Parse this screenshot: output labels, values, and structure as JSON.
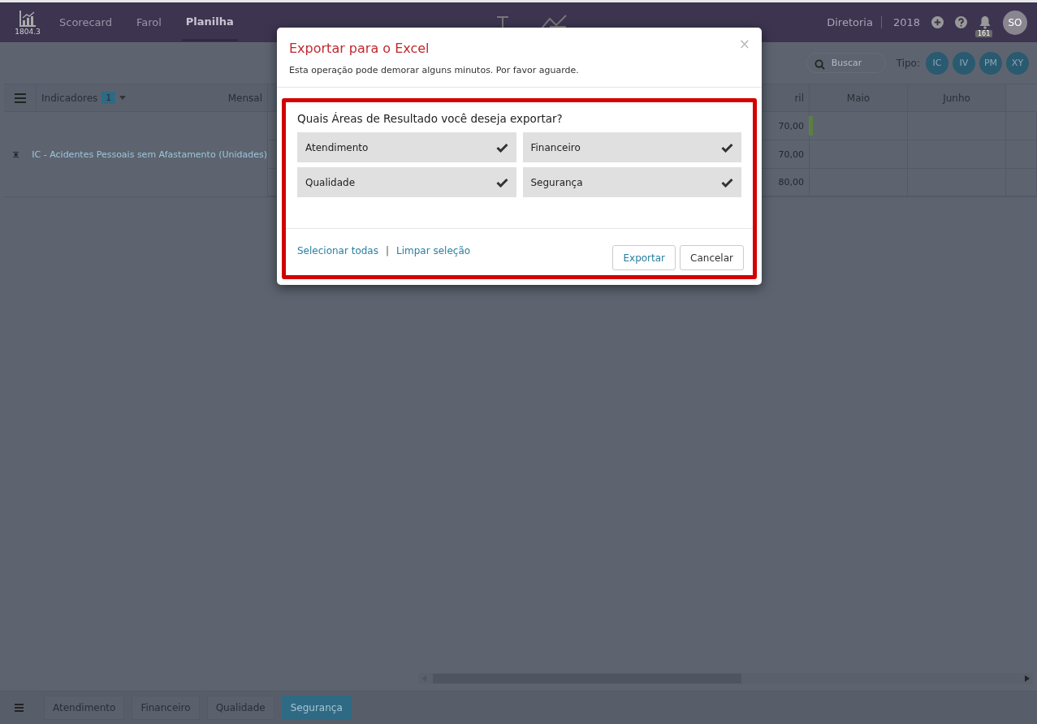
{
  "topbar": {
    "version": "1804.3",
    "nav": [
      {
        "label": "Scorecard",
        "selected": false
      },
      {
        "label": "Farol",
        "selected": false
      },
      {
        "label": "Planilha",
        "selected": true
      }
    ],
    "unit": "Diretoria",
    "year": "2018",
    "notifications": "161",
    "avatar": "SO"
  },
  "toolbar": {
    "search": {
      "placeholder": "Buscar"
    },
    "type_label": "Tipo:",
    "types": [
      "IC",
      "IV",
      "PM",
      "XY"
    ]
  },
  "table": {
    "indicators_label": "Indicadores",
    "indicators_count": "1",
    "period": "Mensal",
    "columns": [
      "ril",
      "Maio",
      "Junho"
    ],
    "indicator": "IC - Acidentes Pessoais sem Afastamento (Unidades)",
    "values": [
      "70,00",
      "70,00",
      "80,00"
    ]
  },
  "bottom_tabs": [
    {
      "label": "Atendimento",
      "selected": false
    },
    {
      "label": "Financeiro",
      "selected": false
    },
    {
      "label": "Qualidade",
      "selected": false
    },
    {
      "label": "Segurança",
      "selected": true
    }
  ],
  "dialog": {
    "title": "Exportar para o Excel",
    "subtitle": "Esta operação pode demorar alguns minutos. Por favor aguarde.",
    "question": "Quais Áreas de Resultado você deseja exportar?",
    "options": [
      {
        "label": "Atendimento",
        "checked": true
      },
      {
        "label": "Financeiro",
        "checked": true
      },
      {
        "label": "Qualidade",
        "checked": true
      },
      {
        "label": "Segurança",
        "checked": true
      }
    ],
    "select_all": "Selecionar todas",
    "separator": "|",
    "clear": "Limpar seleção",
    "buttons": [
      "Exportar",
      "Cancelar"
    ],
    "close": "×"
  }
}
